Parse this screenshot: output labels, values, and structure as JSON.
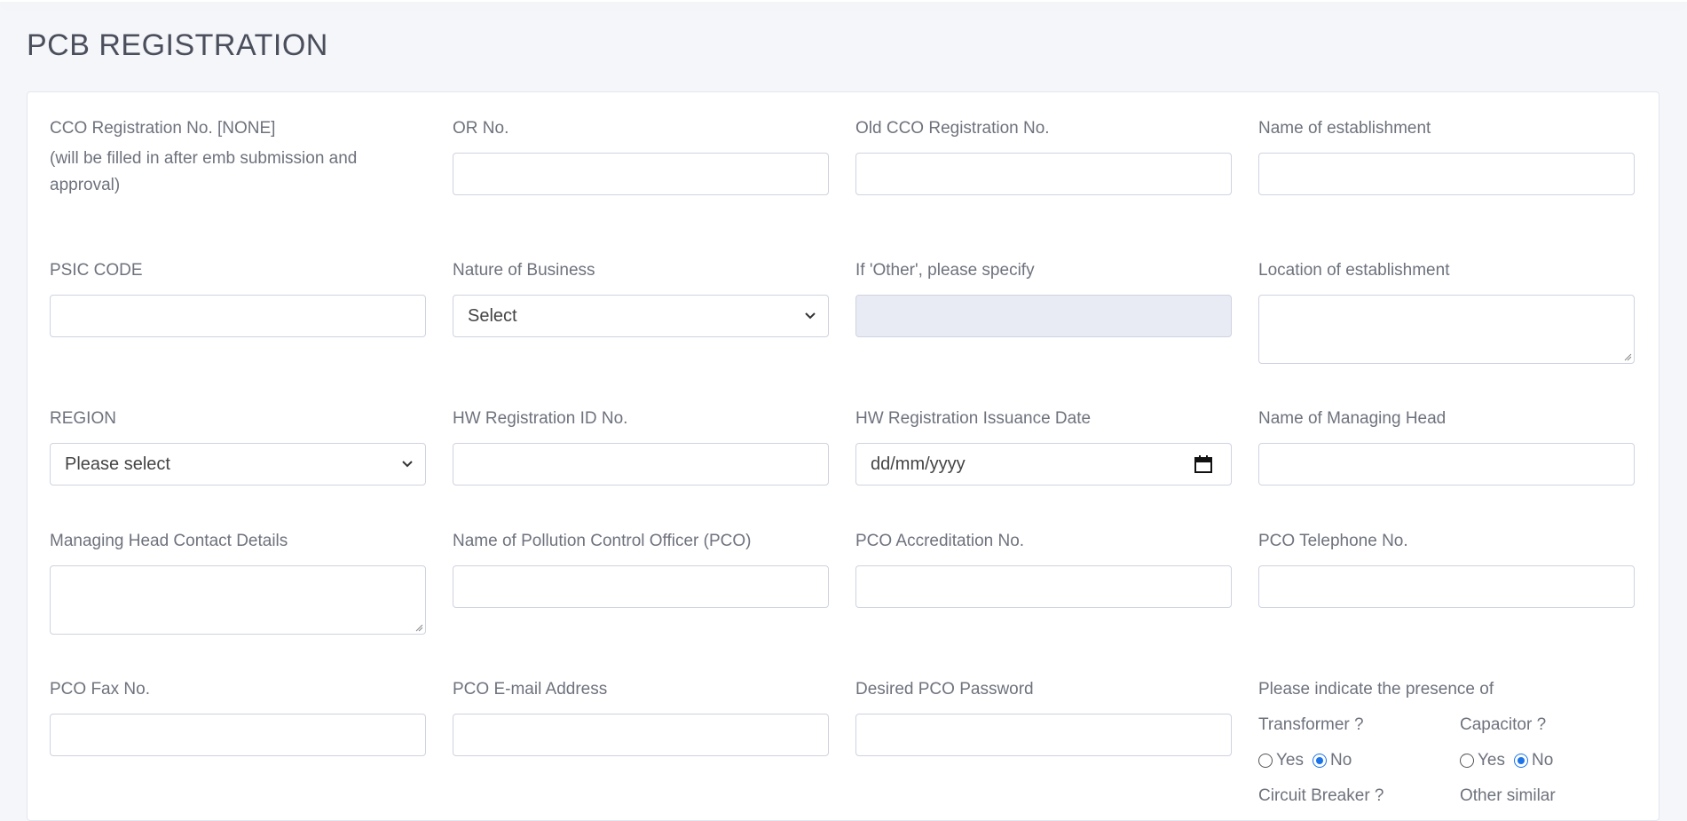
{
  "page": {
    "title": "PCB REGISTRATION"
  },
  "form": {
    "cco_reg_label": "CCO Registration No. [NONE]",
    "cco_reg_note": "(will be filled in after emb submission and approval)",
    "or_no_label": "OR No.",
    "old_cco_label": "Old CCO Registration No.",
    "name_est_label": "Name of establishment",
    "psic_label": "PSIC CODE",
    "nature_label": "Nature of Business",
    "nature_value": "Select",
    "other_specify_label": "If 'Other', please specify",
    "location_label": "Location of establishment",
    "region_label": "REGION",
    "region_value": "Please select",
    "hw_id_label": "HW Registration ID No.",
    "hw_date_label": "HW Registration Issuance Date",
    "hw_date_placeholder": "dd/mm/yyyy",
    "managing_head_label": "Name of Managing Head",
    "mh_contact_label": "Managing Head Contact Details",
    "pco_name_label": "Name of Pollution Control Officer (PCO)",
    "pco_accred_label": "PCO Accreditation No.",
    "pco_tel_label": "PCO Telephone No.",
    "pco_fax_label": "PCO Fax No.",
    "pco_email_label": "PCO E-mail Address",
    "pco_password_label": "Desired PCO Password",
    "presence_label": "Please indicate the presence of",
    "transformer_label": "Transformer ?",
    "capacitor_label": "Capacitor ?",
    "circuit_breaker_label": "Circuit Breaker ?",
    "other_similar_label": "Other similar",
    "yes_label": "Yes",
    "no_label": "No",
    "transformer_selected": "No",
    "capacitor_selected": "No"
  },
  "colors": {
    "accent": "#1a73e8",
    "disabled_bg": "#e8ebf3",
    "border": "#cfd3e0"
  }
}
